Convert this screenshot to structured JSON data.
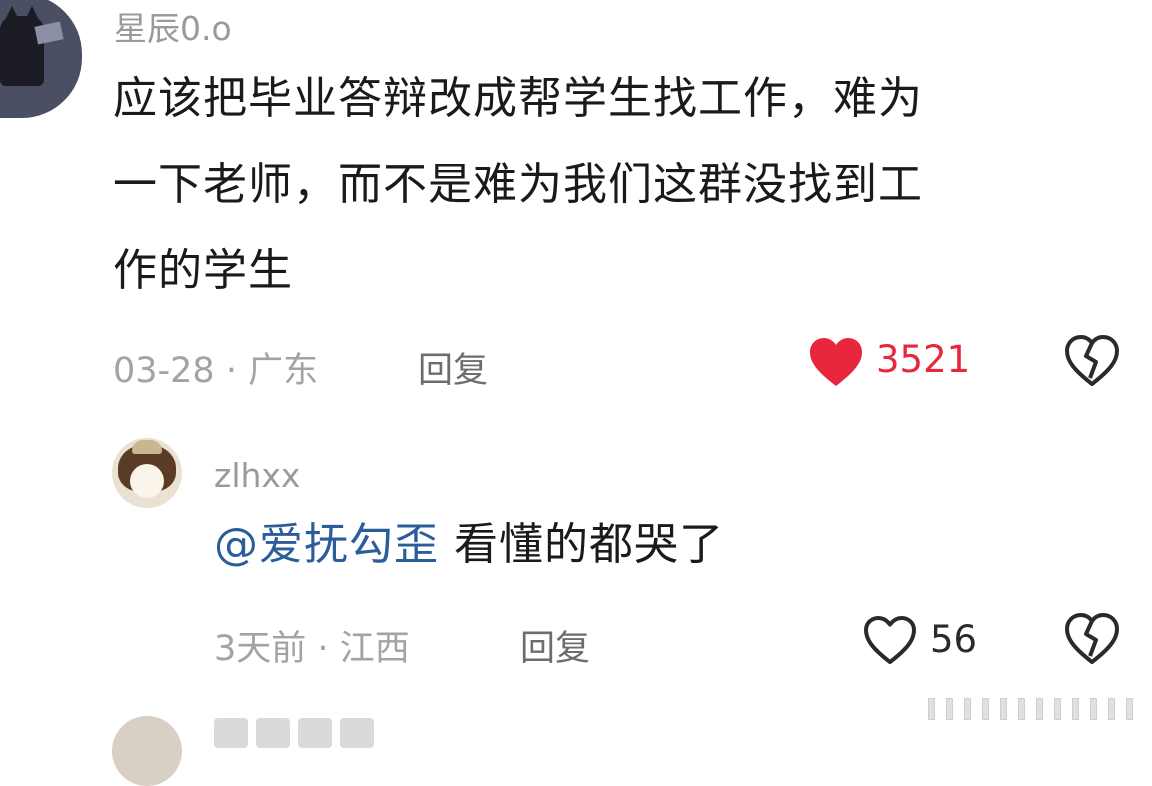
{
  "comment": {
    "username": "星辰0.o",
    "lines": [
      "应该把毕业答辩改成帮学生找工作，难为",
      "一下老师，而不是难为我们这群没找到工",
      "作的学生"
    ],
    "date": "03-28",
    "location": "广东",
    "meta_separator": "·",
    "reply_label": "回复",
    "like_count": "3521",
    "liked": true,
    "like_color": "#e8273c",
    "avatar_icon": "cat-silhouette-avatar",
    "dislike_icon": "broken-heart-icon"
  },
  "reply": {
    "username": "zlhxx",
    "mention": "@爱抚勾歪",
    "text": "看懂的都哭了",
    "date": "3天前",
    "location": "江西",
    "meta_separator": "·",
    "reply_label": "回复",
    "like_count": "56",
    "liked": false,
    "mention_color": "#2b5d9b",
    "avatar_icon": "anime-girl-avatar",
    "dislike_icon": "broken-heart-icon"
  }
}
